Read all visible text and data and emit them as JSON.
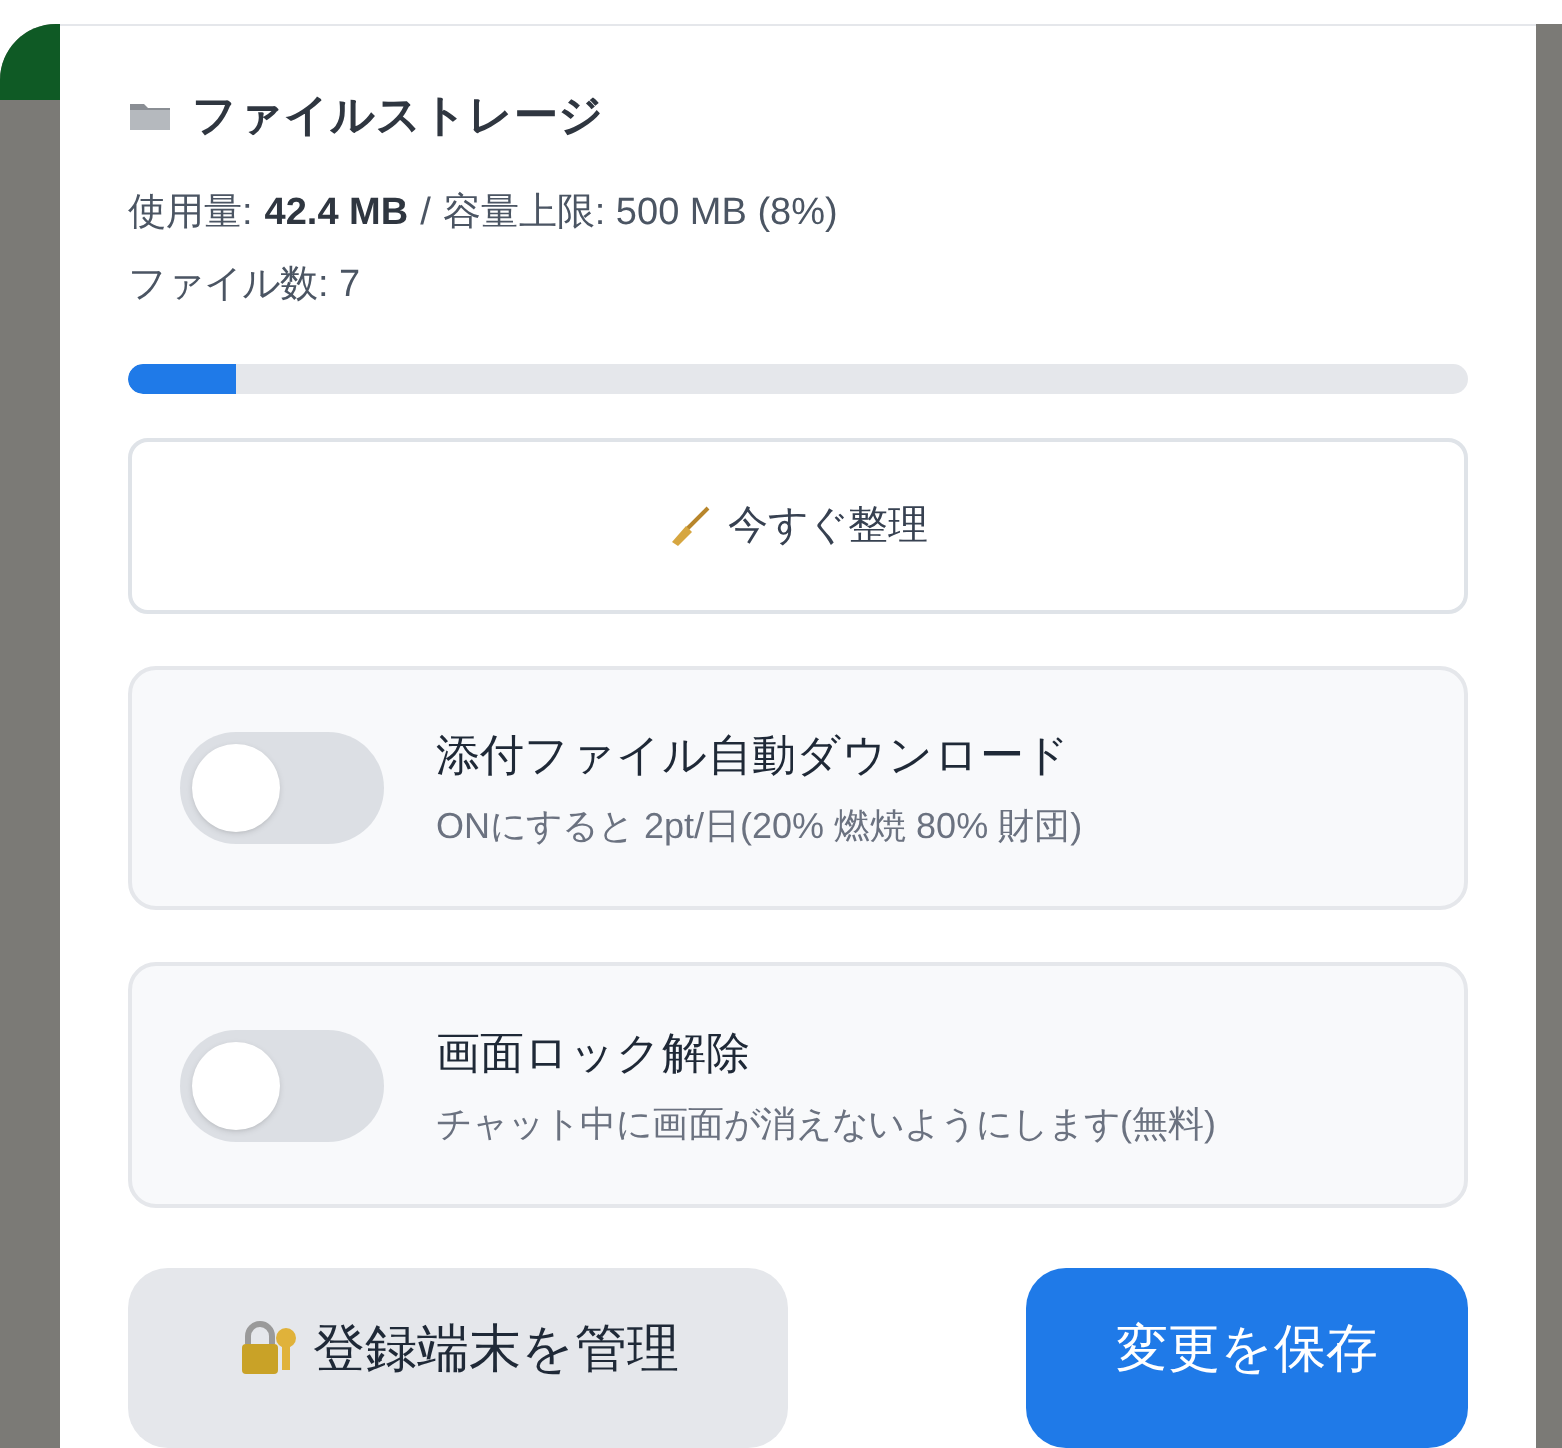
{
  "title": "ファイルストレージ",
  "usage": {
    "label": "使用量:",
    "used": "42.4 MB",
    "separator": "/",
    "limit_label": "容量上限: 500 MB (8%)",
    "file_count": "ファイル数: 7",
    "level": 0.08
  },
  "cleanup_button": "今すぐ整理",
  "toggles": [
    {
      "label": "添付ファイル自動ダウンロード",
      "description": "ONにすると 2pt/日(20% 燃焼 80% 財団)",
      "on": false
    },
    {
      "label": "画面ロック解除",
      "description": "チャット中に画面が消えないようにします(無料)",
      "on": false
    }
  ],
  "buttons": [
    {
      "label": "登録端末を管理",
      "kind": "secondary"
    },
    {
      "label": "変更を保存",
      "kind": "primary"
    }
  ]
}
